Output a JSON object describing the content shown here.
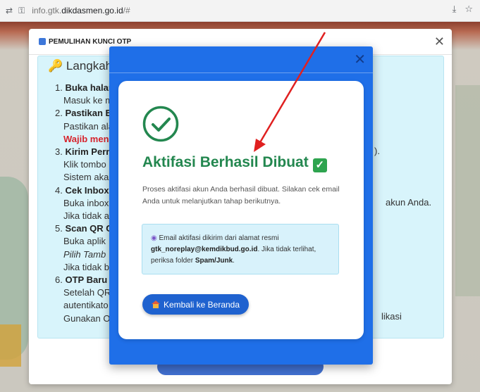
{
  "browser": {
    "url_prefix": "info.gtk.",
    "url_domain": "dikdasmen.go.id",
    "url_suffix": "/#",
    "icons": [
      "site-settings-icon",
      "key-icon",
      "download-icon",
      "bookmark-star-icon"
    ]
  },
  "back_modal": {
    "title": "PEMULIHAN KUNCI OTP",
    "steps_title": "Langkah",
    "steps": [
      {
        "num": "1.",
        "title": "Buka halam",
        "lines": [
          "Masuk ke m"
        ]
      },
      {
        "num": "2.",
        "title": "Pastikan E",
        "lines": [
          "Pastikan ala"
        ],
        "warning": "Wajib mena"
      },
      {
        "num": "3.",
        "title": "Kirim Perm",
        "lines": [
          "Klik tombo",
          "Sistem aka"
        ]
      },
      {
        "num": "4.",
        "title": "Cek Inbox",
        "lines": [
          "Buka inbox",
          "Jika tidak a"
        ]
      },
      {
        "num": "5.",
        "title": "Scan QR C",
        "lines": [
          "Buka aplik",
          "Pilih Tamb",
          "Jika tidak b"
        ]
      },
      {
        "num": "6.",
        "title": "OTP Baru A",
        "lines": [
          "Setelah QR",
          "autentikato",
          "Gunakan O"
        ]
      }
    ],
    "right_fragments": [
      ").",
      "akun Anda.",
      "likasi"
    ]
  },
  "success_modal": {
    "title": "Aktifasi Berhasil Dibuat",
    "description": "Proses aktifasi akun Anda berhasil dibuat. Silakan cek email Anda untuk melanjutkan tahap berikutnya.",
    "info_intro": "Email aktifasi dikirim dari alamat resmi",
    "info_email": "gtk_noreplay@kemdikbud.go.id",
    "info_mid": ". Jika tidak terlihat, periksa folder ",
    "info_folder": "Spam/Junk",
    "info_end": ".",
    "button_label": "Kembali ke Beranda",
    "colors": {
      "accent": "#1f6fe8",
      "success": "#23874f",
      "info_bg": "#d8f2fb"
    }
  }
}
